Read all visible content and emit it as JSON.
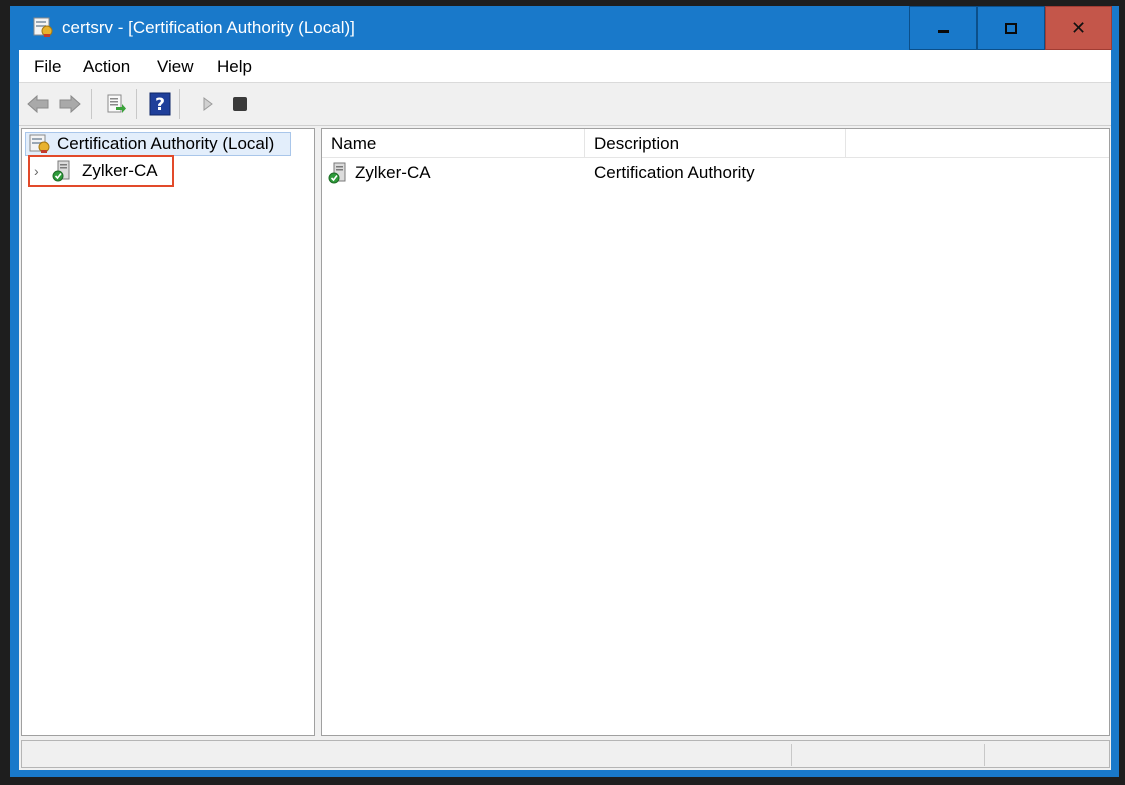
{
  "window": {
    "title": "certsrv - [Certification Authority (Local)]",
    "icon": "certsrv-app-icon",
    "accent_color": "#1979ca",
    "close_color": "#c4564a"
  },
  "menu": {
    "items": [
      "File",
      "Action",
      "View",
      "Help"
    ]
  },
  "toolbar": {
    "buttons": [
      "back-icon",
      "forward-icon",
      "export-list-icon",
      "help-icon",
      "start-service-icon",
      "stop-service-icon"
    ]
  },
  "tree": {
    "root_label": "Certification Authority (Local)",
    "child_label": "Zylker-CA",
    "highlight_color": "#e24a2a"
  },
  "list": {
    "columns": [
      "Name",
      "Description"
    ],
    "rows": [
      {
        "name": "Zylker-CA",
        "description": "Certification Authority"
      }
    ]
  }
}
